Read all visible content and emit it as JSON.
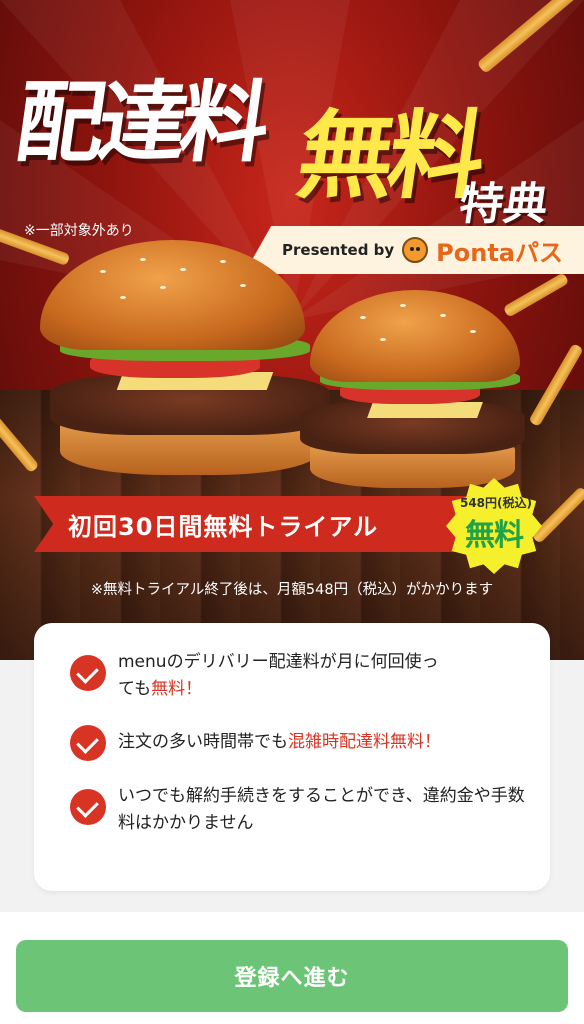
{
  "hero": {
    "title_part1": "配達料",
    "title_part2": "無料",
    "title_part3": "特典",
    "disclaimer": "※一部対象外あり",
    "presented_label": "Presented by",
    "partner_brand": "Ponta",
    "partner_suffix": "パス",
    "trial_banner": "初回30日間無料トライアル",
    "badge_price": "548円(税込)",
    "badge_free": "無料",
    "trial_note": "※無料トライアル終了後は、月額548円（税込）がかかります"
  },
  "benefits": [
    {
      "text_prefix": "menuのデリバリー配達料が月に何回使っても",
      "highlight": "無料！",
      "text_suffix": ""
    },
    {
      "text_prefix": "注文の多い時間帯でも",
      "highlight": "混雑時配達料無料！",
      "text_suffix": ""
    },
    {
      "text_prefix": "いつでも解約手続きをすることができ、違約金や手数料はかかりません",
      "highlight": "",
      "text_suffix": ""
    }
  ],
  "cta": {
    "label": "登録へ進む"
  },
  "colors": {
    "brand_red": "#d73424",
    "cta_green": "#6cc476",
    "title_yellow": "#ffe94a",
    "badge_yellow": "#f6ef2c",
    "ponta_orange": "#e8661a"
  },
  "icons": [
    "check-icon",
    "ponta-mascot-icon"
  ]
}
